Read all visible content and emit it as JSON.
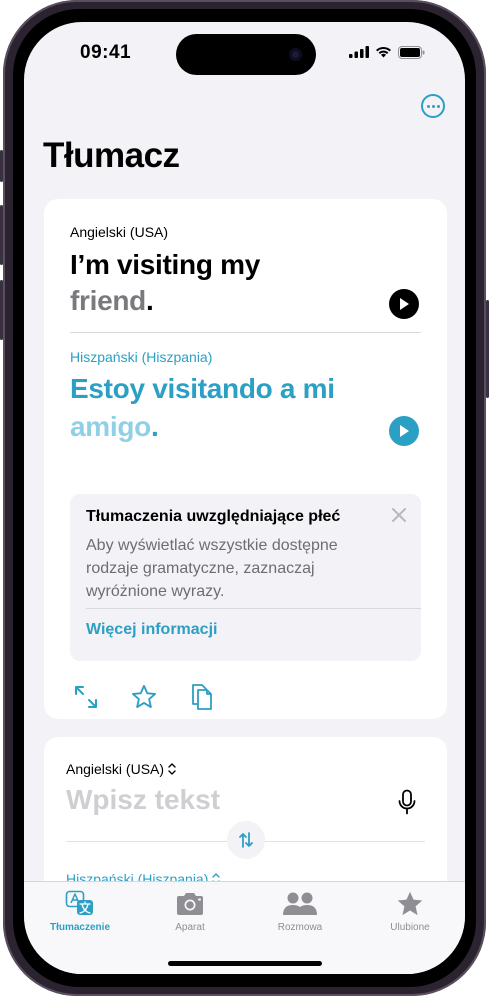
{
  "status_bar": {
    "time": "09:41"
  },
  "header": {
    "title": "Tłumacz",
    "more_icon": "ellipsis-circle-icon"
  },
  "translation": {
    "source_lang": "Angielski (USA)",
    "source_text_main": "I’m visiting my",
    "source_text_dim": "friend",
    "source_text_end": ".",
    "target_lang": "Hiszpański (Hiszpania)",
    "target_text_main": "Estoy visitando a mi",
    "target_text_dim": "amigo",
    "target_text_end": "."
  },
  "gender_info": {
    "title": "Tłumaczenia uwzględniające płeć",
    "body": "Aby wyświetlać wszystkie dostępne rodzaje gramatyczne, zaznaczaj wyróżnione wyrazy.",
    "link": "Więcej informacji"
  },
  "input": {
    "source_lang": "Angielski (USA)",
    "placeholder": "Wpisz tekst",
    "target_lang": "Hiszpański (Hiszpania)"
  },
  "tabs": [
    {
      "label": "Tłumaczenie",
      "icon": "translate-icon",
      "active": true
    },
    {
      "label": "Aparat",
      "icon": "camera-icon",
      "active": false
    },
    {
      "label": "Rozmowa",
      "icon": "people-icon",
      "active": false
    },
    {
      "label": "Ulubione",
      "icon": "star-icon",
      "active": false
    }
  ],
  "colors": {
    "accent": "#2c9fc4",
    "background": "#f2f2f7"
  }
}
